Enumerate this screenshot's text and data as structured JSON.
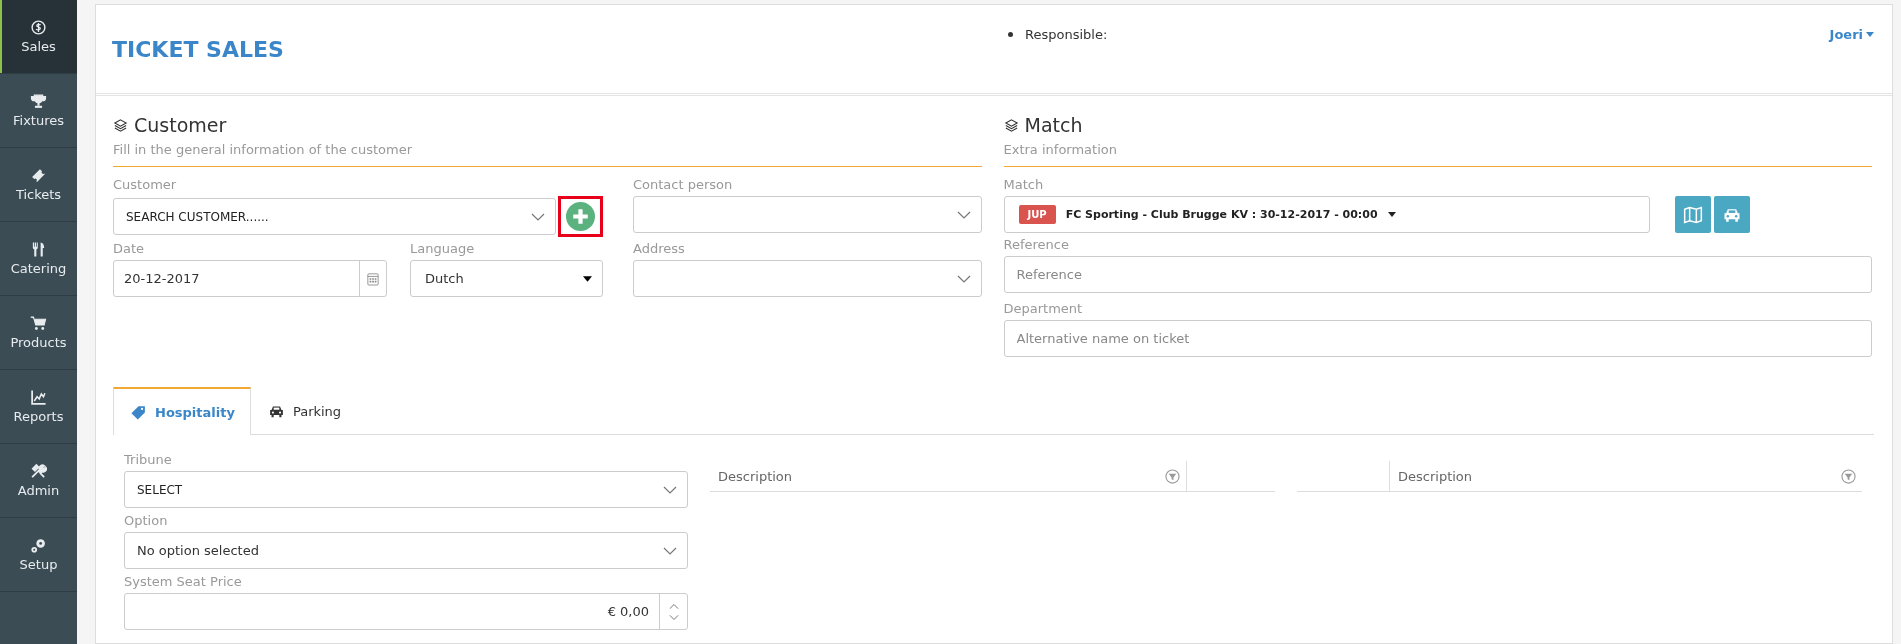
{
  "sidebar": {
    "items": [
      {
        "label": "Sales",
        "selected": true
      },
      {
        "label": "Fixtures",
        "selected": false
      },
      {
        "label": "Tickets",
        "selected": false
      },
      {
        "label": "Catering",
        "selected": false
      },
      {
        "label": "Products",
        "selected": false
      },
      {
        "label": "Reports",
        "selected": false
      },
      {
        "label": "Admin",
        "selected": false
      },
      {
        "label": "Setup",
        "selected": false
      }
    ]
  },
  "header": {
    "title": "TICKET SALES",
    "responsible_label": "Responsible:",
    "user": "Joeri"
  },
  "customer": {
    "title": "Customer",
    "subtitle": "Fill in the general information of the customer",
    "customer_field": {
      "label": "Customer",
      "value": "SEARCH CUSTOMER......"
    },
    "contact_field": {
      "label": "Contact person"
    },
    "date_field": {
      "label": "Date",
      "value": "20-12-2017"
    },
    "language_field": {
      "label": "Language",
      "value": "Dutch"
    },
    "address_field": {
      "label": "Address"
    }
  },
  "match": {
    "title": "Match",
    "subtitle": "Extra information",
    "match_field": {
      "label": "Match",
      "badge": "JUP",
      "value": "FC Sporting - Club Brugge KV : 30-12-2017 - 00:00"
    },
    "reference_field": {
      "label": "Reference",
      "placeholder": "Reference"
    },
    "department_field": {
      "label": "Department",
      "placeholder": "Alternative name on ticket"
    }
  },
  "tabs": [
    {
      "label": "Hospitality",
      "selected": true
    },
    {
      "label": "Parking",
      "selected": false
    }
  ],
  "hospitality": {
    "tribune": {
      "label": "Tribune",
      "value": "SELECT"
    },
    "option": {
      "label": "Option",
      "value": "No option selected"
    },
    "seat_price": {
      "label": "System Seat Price",
      "value": "€ 0,00"
    }
  },
  "tables": [
    {
      "columns": [
        {
          "label": "Description",
          "filterable": true
        },
        {
          "filterable": false
        }
      ]
    },
    {
      "columns": [
        {
          "filterable": false
        },
        {
          "label": "Description",
          "filterable": true
        }
      ]
    }
  ]
}
